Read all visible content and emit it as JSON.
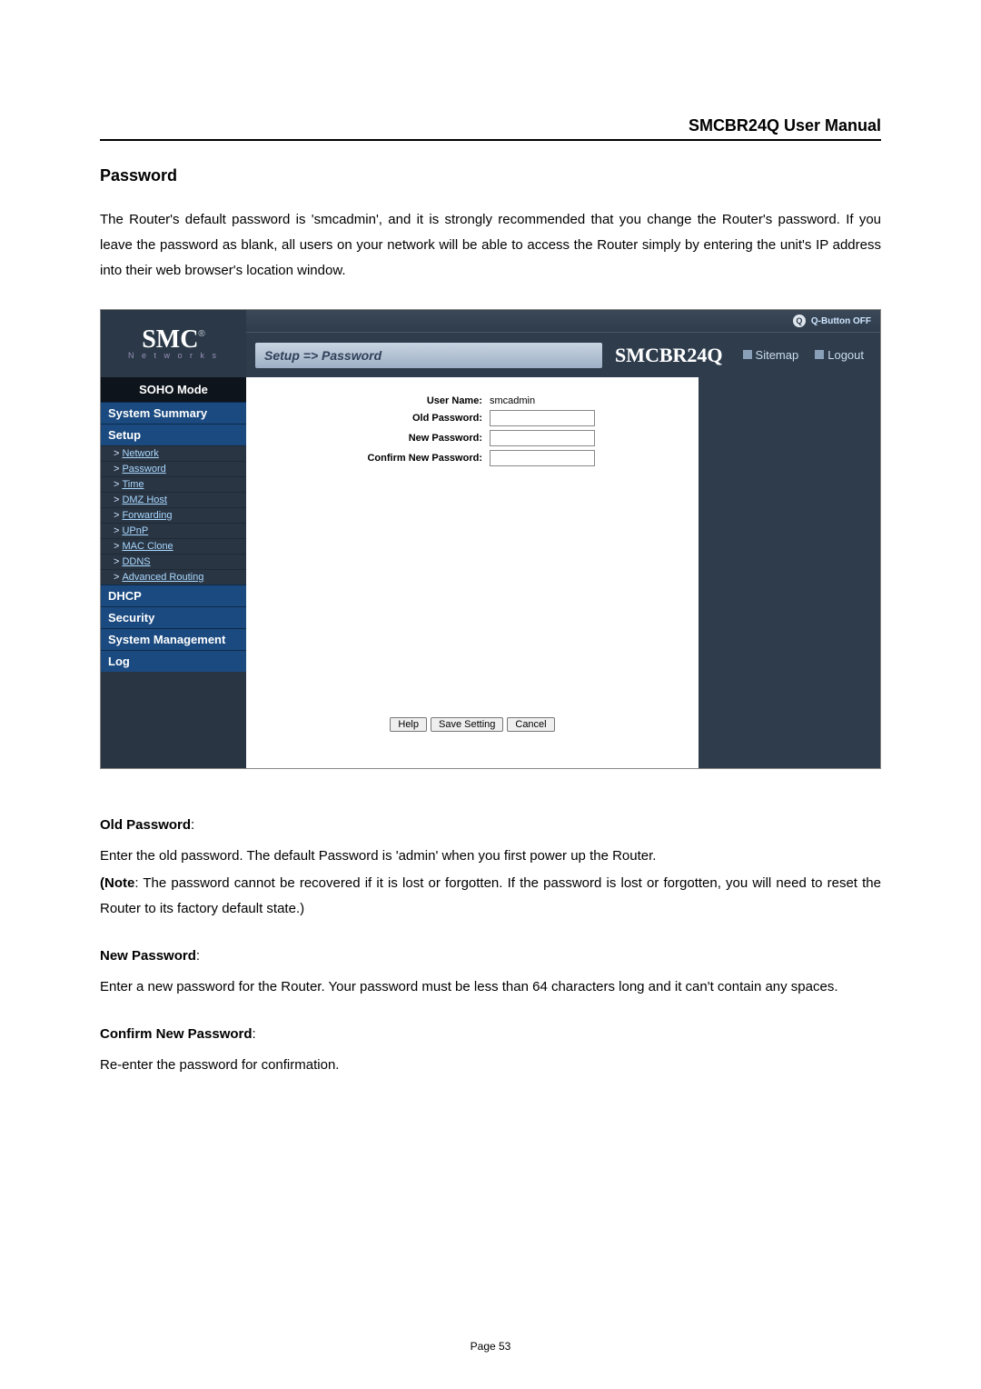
{
  "document": {
    "header_title": "SMCBR24Q User Manual",
    "section_title": "Password",
    "intro_para": "The Router's default password is 'smcadmin', and it is strongly recommended that you change the Router's password. If you leave the password as blank, all users on your network will be able to access the Router simply by entering the unit's IP address into their web browser's location window.",
    "old_pw_heading": "Old Password",
    "old_pw_text": "Enter the old password. The default Password is 'admin' when you first power up the Router.",
    "note_label": "(Note",
    "note_text": ": The password cannot be recovered if it is lost or forgotten. If the password is lost or forgotten, you will need to reset the Router to its factory default state.)",
    "new_pw_heading": "New Password",
    "new_pw_text": "Enter a new password for the Router. Your password must be less than 64 characters long and it can't contain any spaces.",
    "confirm_pw_heading": "Confirm New Password",
    "confirm_pw_text": "Re-enter the password for confirmation.",
    "page_number": "Page 53"
  },
  "router": {
    "logo_main": "SMC",
    "logo_reg": "®",
    "logo_sub": "N e t w o r k s",
    "qbutton_label": "Q-Button OFF",
    "breadcrumb": "Setup => Password",
    "model": "SMCBR24Q",
    "link_sitemap": "Sitemap",
    "link_logout": "Logout",
    "nav": {
      "mode": "SOHO Mode",
      "cat_summary": "System Summary",
      "cat_setup": "Setup",
      "sub_setup": [
        "Network",
        "Password",
        "Time",
        "DMZ Host",
        "Forwarding",
        "UPnP",
        "MAC Clone",
        "DDNS",
        "Advanced Routing"
      ],
      "cat_dhcp": "DHCP",
      "cat_security": "Security",
      "cat_sysmgmt": "System Management",
      "cat_log": "Log"
    },
    "form": {
      "username_label": "User Name:",
      "username_value": "smcadmin",
      "old_pw_label": "Old Password:",
      "new_pw_label": "New Password:",
      "confirm_pw_label": "Confirm New Password:"
    },
    "buttons": {
      "help": "Help",
      "save": "Save Setting",
      "cancel": "Cancel"
    }
  }
}
